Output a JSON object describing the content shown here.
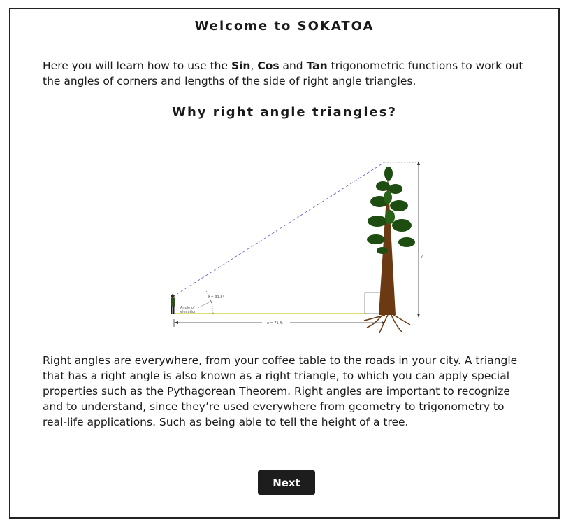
{
  "page": {
    "title": "Welcome to SOKATOA",
    "intro": {
      "prefix": "Here you will learn how to use the ",
      "sin": "Sin",
      "sep1": ", ",
      "cos": "Cos",
      "sep2": " and ",
      "tan": "Tan",
      "suffix": " trigonometric functions to work out the angles of corners and lengths of the side of right angle triangles."
    },
    "subtitle": "Why right angle triangles?",
    "figure": {
      "angle_label": "θ = 31.8°",
      "elevation_label_1": "Angle of",
      "elevation_label_2": "elevation",
      "x_label": "x = 71 ft.",
      "y_label": "y"
    },
    "body": "Right angles are everywhere, from your coffee table to the roads in your city. A triangle that has a right angle is also known as a right triangle, to which you can apply special properties such as the Pythagorean Theorem. Right angles are important to recognize and to understand, since they’re used everywhere from geometry to trigonometry to real-life applications. Such as being able to tell the height of a tree.",
    "next_button": "Next"
  }
}
